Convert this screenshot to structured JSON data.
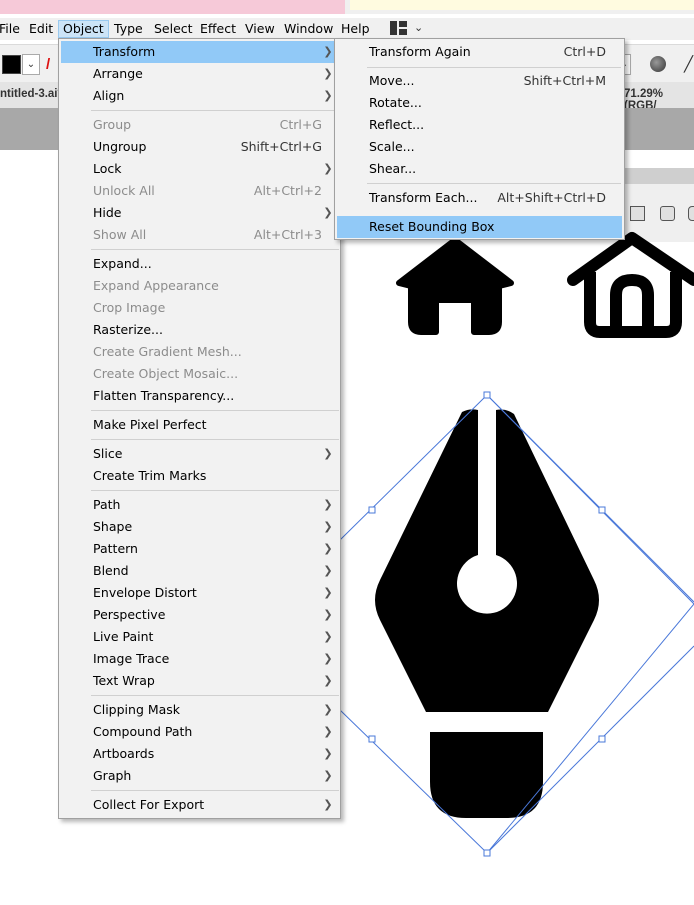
{
  "menubar": {
    "items": [
      "File",
      "Edit",
      "Object",
      "Type",
      "Select",
      "Effect",
      "View",
      "Window",
      "Help"
    ]
  },
  "document": {
    "tab_title": "ntitled-3.ai*",
    "zoom_label": "71.29% (RGB/"
  },
  "object_menu": {
    "items": [
      {
        "label": "Transform",
        "submenu": true,
        "highlighted": true
      },
      {
        "label": "Arrange",
        "submenu": true
      },
      {
        "label": "Align",
        "submenu": true
      },
      {
        "label": "Group",
        "shortcut": "Ctrl+G",
        "disabled": true
      },
      {
        "label": "Ungroup",
        "shortcut": "Shift+Ctrl+G"
      },
      {
        "label": "Lock",
        "submenu": true
      },
      {
        "label": "Unlock All",
        "shortcut": "Alt+Ctrl+2",
        "disabled": true
      },
      {
        "label": "Hide",
        "submenu": true
      },
      {
        "label": "Show All",
        "shortcut": "Alt+Ctrl+3",
        "disabled": true
      },
      {
        "label": "Expand..."
      },
      {
        "label": "Expand Appearance",
        "disabled": true
      },
      {
        "label": "Crop Image",
        "disabled": true
      },
      {
        "label": "Rasterize..."
      },
      {
        "label": "Create Gradient Mesh...",
        "disabled": true
      },
      {
        "label": "Create Object Mosaic...",
        "disabled": true
      },
      {
        "label": "Flatten Transparency..."
      },
      {
        "label": "Make Pixel Perfect"
      },
      {
        "label": "Slice",
        "submenu": true
      },
      {
        "label": "Create Trim Marks"
      },
      {
        "label": "Path",
        "submenu": true
      },
      {
        "label": "Shape",
        "submenu": true
      },
      {
        "label": "Pattern",
        "submenu": true
      },
      {
        "label": "Blend",
        "submenu": true
      },
      {
        "label": "Envelope Distort",
        "submenu": true
      },
      {
        "label": "Perspective",
        "submenu": true
      },
      {
        "label": "Live Paint",
        "submenu": true
      },
      {
        "label": "Image Trace",
        "submenu": true
      },
      {
        "label": "Text Wrap",
        "submenu": true
      },
      {
        "label": "Clipping Mask",
        "submenu": true
      },
      {
        "label": "Compound Path",
        "submenu": true
      },
      {
        "label": "Artboards",
        "submenu": true
      },
      {
        "label": "Graph",
        "submenu": true
      },
      {
        "label": "Collect For Export",
        "submenu": true
      }
    ]
  },
  "transform_submenu": {
    "items": [
      {
        "label": "Transform Again",
        "shortcut": "Ctrl+D"
      },
      {
        "label": "Move...",
        "shortcut": "Shift+Ctrl+M"
      },
      {
        "label": "Rotate..."
      },
      {
        "label": "Reflect..."
      },
      {
        "label": "Scale..."
      },
      {
        "label": "Shear..."
      },
      {
        "label": "Transform Each...",
        "shortcut": "Alt+Shift+Ctrl+D"
      },
      {
        "label": "Reset Bounding Box",
        "highlighted": true
      }
    ]
  },
  "colors": {
    "menu_highlight": "#91c9f7",
    "menubar_active": "#cce4f7",
    "selection_box": "#4a78d9",
    "fill_swatch": "#000000"
  },
  "icons": [
    "house-filled-icon",
    "house-outline-icon",
    "pen-tool-nib-icon",
    "workspace-switcher-icon",
    "globe-icon"
  ]
}
